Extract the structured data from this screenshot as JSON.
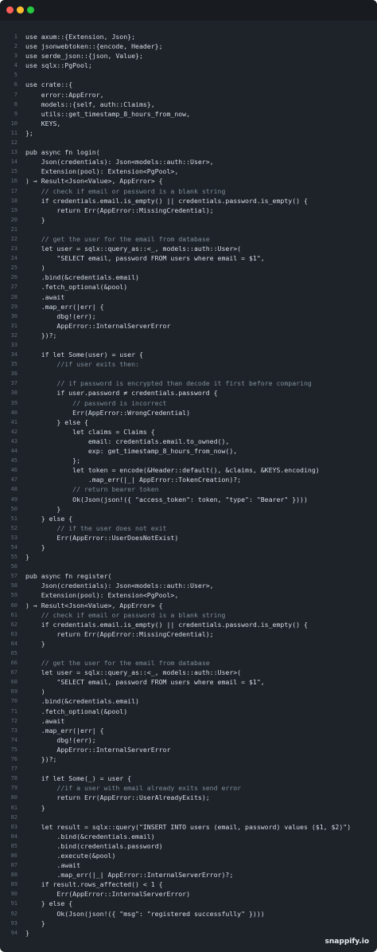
{
  "window": {
    "controls": [
      "close",
      "minimize",
      "maximize"
    ]
  },
  "watermark": "snappify.io",
  "lines": [
    {
      "n": "1",
      "t": "use axum::{Extension, Json};"
    },
    {
      "n": "2",
      "t": "use jsonwebtoken::{encode, Header};"
    },
    {
      "n": "3",
      "t": "use serde_json::{json, Value};"
    },
    {
      "n": "4",
      "t": "use sqlx::PgPool;"
    },
    {
      "n": "5",
      "t": ""
    },
    {
      "n": "6",
      "t": "use crate::{"
    },
    {
      "n": "7",
      "t": "    error::AppError,"
    },
    {
      "n": "8",
      "t": "    models::{self, auth::Claims},"
    },
    {
      "n": "9",
      "t": "    utils::get_timestamp_8_hours_from_now,"
    },
    {
      "n": "10",
      "t": "    KEYS,"
    },
    {
      "n": "11",
      "t": "};"
    },
    {
      "n": "12",
      "t": ""
    },
    {
      "n": "13",
      "t": "pub async fn login("
    },
    {
      "n": "14",
      "t": "    Json(credentials): Json<models::auth::User>,"
    },
    {
      "n": "15",
      "t": "    Extension(pool): Extension<PgPool>,"
    },
    {
      "n": "16",
      "t": ") → Result<Json<Value>, AppError> {"
    },
    {
      "n": "17",
      "t": "    // check if email or password is a blank string"
    },
    {
      "n": "18",
      "t": "    if credentials.email.is_empty() || credentials.password.is_empty() {"
    },
    {
      "n": "19",
      "t": "        return Err(AppError::MissingCredential);"
    },
    {
      "n": "20",
      "t": "    }"
    },
    {
      "n": "21",
      "t": ""
    },
    {
      "n": "22",
      "t": "    // get the user for the email from database"
    },
    {
      "n": "23",
      "t": "    let user = sqlx::query_as::<_, models::auth::User>("
    },
    {
      "n": "24",
      "t": "        \"SELECT email, password FROM users where email = $1\","
    },
    {
      "n": "25",
      "t": "    )"
    },
    {
      "n": "26",
      "t": "    .bind(&credentials.email)"
    },
    {
      "n": "27",
      "t": "    .fetch_optional(&pool)"
    },
    {
      "n": "28",
      "t": "    .await"
    },
    {
      "n": "29",
      "t": "    .map_err(|err| {"
    },
    {
      "n": "30",
      "t": "        dbg!(err);"
    },
    {
      "n": "31",
      "t": "        AppError::InternalServerError"
    },
    {
      "n": "32",
      "t": "    })?;"
    },
    {
      "n": "33",
      "t": ""
    },
    {
      "n": "34",
      "t": "    if let Some(user) = user {"
    },
    {
      "n": "35",
      "t": "        //if user exits then:"
    },
    {
      "n": "36",
      "t": ""
    },
    {
      "n": "37",
      "t": "        // if password is encrypted than decode it first before comparing"
    },
    {
      "n": "38",
      "t": "        if user.password ≠ credentials.password {"
    },
    {
      "n": "39",
      "t": "            // password is incorrect"
    },
    {
      "n": "40",
      "t": "            Err(AppError::WrongCredential)"
    },
    {
      "n": "41",
      "t": "        } else {"
    },
    {
      "n": "42",
      "t": "            let claims = Claims {"
    },
    {
      "n": "43",
      "t": "                email: credentials.email.to_owned(),"
    },
    {
      "n": "44",
      "t": "                exp: get_timestamp_8_hours_from_now(),"
    },
    {
      "n": "45",
      "t": "            };"
    },
    {
      "n": "46",
      "t": "            let token = encode(&Header::default(), &claims, &KEYS.encoding)"
    },
    {
      "n": "47",
      "t": "                .map_err(|_| AppError::TokenCreation)?;"
    },
    {
      "n": "48",
      "t": "            // return bearer token"
    },
    {
      "n": "49",
      "t": "            Ok(Json(json!({ \"access_token\": token, \"type\": \"Bearer\" })))"
    },
    {
      "n": "50",
      "t": "        }"
    },
    {
      "n": "51",
      "t": "    } else {"
    },
    {
      "n": "52",
      "t": "        // if the user does not exit"
    },
    {
      "n": "53",
      "t": "        Err(AppError::UserDoesNotExist)"
    },
    {
      "n": "54",
      "t": "    }"
    },
    {
      "n": "55",
      "t": "}"
    },
    {
      "n": "56",
      "t": ""
    },
    {
      "n": "57",
      "t": "pub async fn register("
    },
    {
      "n": "58",
      "t": "    Json(credentials): Json<models::auth::User>,"
    },
    {
      "n": "59",
      "t": "    Extension(pool): Extension<PgPool>,"
    },
    {
      "n": "60",
      "t": ") → Result<Json<Value>, AppError> {"
    },
    {
      "n": "61",
      "t": "    // check if email or password is a blank string"
    },
    {
      "n": "62",
      "t": "    if credentials.email.is_empty() || credentials.password.is_empty() {"
    },
    {
      "n": "63",
      "t": "        return Err(AppError::MissingCredential);"
    },
    {
      "n": "64",
      "t": "    }"
    },
    {
      "n": "65",
      "t": ""
    },
    {
      "n": "66",
      "t": "    // get the user for the email from database"
    },
    {
      "n": "67",
      "t": "    let user = sqlx::query_as::<_, models::auth::User>("
    },
    {
      "n": "68",
      "t": "        \"SELECT email, password FROM users where email = $1\","
    },
    {
      "n": "69",
      "t": "    )"
    },
    {
      "n": "70",
      "t": "    .bind(&credentials.email)"
    },
    {
      "n": "71",
      "t": "    .fetch_optional(&pool)"
    },
    {
      "n": "72",
      "t": "    .await"
    },
    {
      "n": "73",
      "t": "    .map_err(|err| {"
    },
    {
      "n": "74",
      "t": "        dbg!(err);"
    },
    {
      "n": "75",
      "t": "        AppError::InternalServerError"
    },
    {
      "n": "76",
      "t": "    })?;"
    },
    {
      "n": "77",
      "t": ""
    },
    {
      "n": "78",
      "t": "    if let Some(_) = user {"
    },
    {
      "n": "79",
      "t": "        //if a user with email already exits send error"
    },
    {
      "n": "80",
      "t": "        return Err(AppError::UserAlreadyExits);"
    },
    {
      "n": "81",
      "t": "    }"
    },
    {
      "n": "82",
      "t": ""
    },
    {
      "n": "83",
      "t": "    let result = sqlx::query(\"INSERT INTO users (email, password) values ($1, $2)\")"
    },
    {
      "n": "84",
      "t": "        .bind(&credentials.email)"
    },
    {
      "n": "85",
      "t": "        .bind(credentials.password)"
    },
    {
      "n": "86",
      "t": "        .execute(&pool)"
    },
    {
      "n": "87",
      "t": "        .await"
    },
    {
      "n": "88",
      "t": "        .map_err(|_| AppError::InternalServerError)?;"
    },
    {
      "n": "89",
      "t": "    if result.rows_affected() < 1 {"
    },
    {
      "n": "90",
      "t": "        Err(AppError::InternalServerError)"
    },
    {
      "n": "91",
      "t": "    } else {"
    },
    {
      "n": "92",
      "t": "        Ok(Json(json!({ \"msg\": \"registered successfully\" })))"
    },
    {
      "n": "93",
      "t": "    }"
    },
    {
      "n": "94",
      "t": "}"
    }
  ]
}
